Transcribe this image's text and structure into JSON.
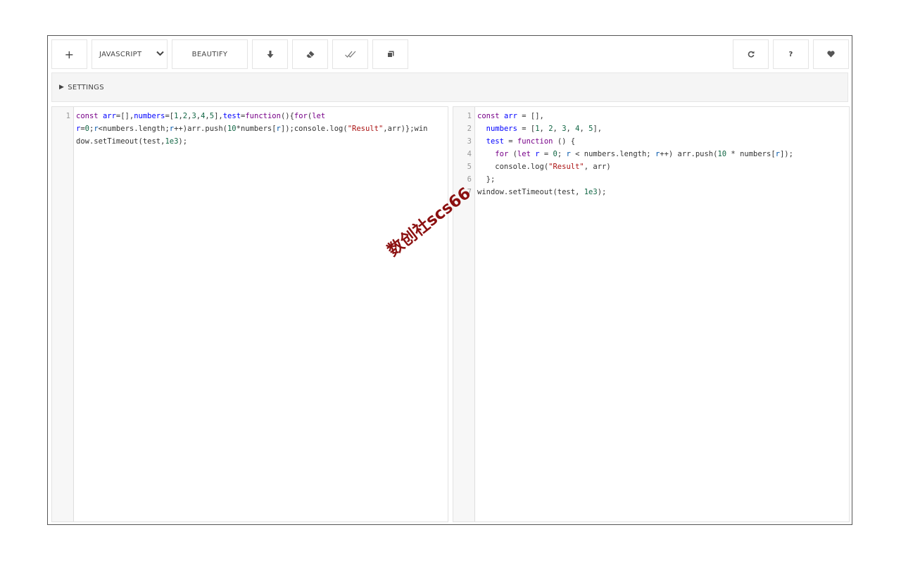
{
  "toolbar": {
    "add_label": "+",
    "language": "JAVASCRIPT",
    "beautify_label": "BEAUTIFY"
  },
  "icons": {
    "add": "plus-icon",
    "language_caret": "chevron-down-icon",
    "download": "download-arrow-icon",
    "clear": "eraser-icon",
    "validate": "double-check-icon",
    "copy": "copy-icon",
    "refresh": "refresh-icon",
    "help": "help-icon",
    "favorite": "heart-icon"
  },
  "help_label": "?",
  "settings": {
    "toggle_glyph": "▶",
    "label": "SETTINGS"
  },
  "input_editor": {
    "line_numbers": [
      "1"
    ],
    "wrapped_lines": [
      "const arr=[],numbers=[1,2,3,4,5],test=function(){for(let",
      "r=0;r<numbers.length;r++)arr.push(10*numbers[r]);console.log(\"Result\",arr)};win",
      "dow.setTimeout(test,1e3);"
    ]
  },
  "output_editor": {
    "line_numbers": [
      "1",
      "2",
      "3",
      "4",
      "5",
      "6",
      "7"
    ],
    "lines": [
      "const arr = [],",
      "  numbers = [1, 2, 3, 4, 5],",
      "  test = function () {",
      "    for (let r = 0; r < numbers.length; r++) arr.push(10 * numbers[r]);",
      "    console.log(\"Result\", arr)",
      "  };",
      "window.setTimeout(test, 1e3);"
    ]
  },
  "watermark": "数创社scs66",
  "colors": {
    "keyword": "#770088",
    "definition": "#0000ff",
    "number": "#116644",
    "string": "#aa1111",
    "watermark": "#8b1010"
  }
}
